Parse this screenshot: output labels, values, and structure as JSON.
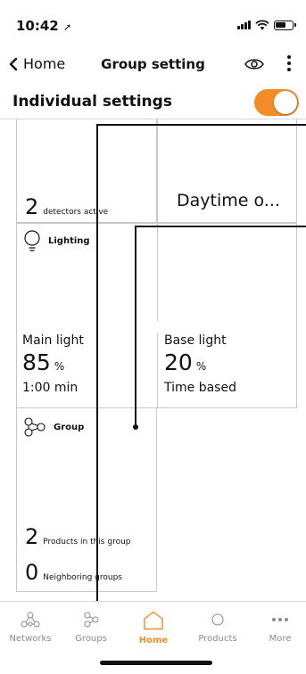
{
  "status_bar": {
    "time": "10:42"
  },
  "nav": {
    "back_label": "Home",
    "title": "Group setting"
  },
  "section": {
    "title": "Individual settings",
    "toggle_on": true,
    "accent": "#f28c28"
  },
  "tiles": {
    "detectors": {
      "value": "2",
      "label": "detectors active"
    },
    "daytime": {
      "value": "Daytime o..."
    },
    "lighting": {
      "title": "Lighting",
      "main": {
        "name": "Main light",
        "value": "85",
        "unit": "%",
        "extra": "1:00 min"
      },
      "base": {
        "name": "Base light",
        "value": "20",
        "unit": "%",
        "extra": "Time based"
      }
    },
    "group": {
      "title": "Group",
      "products_value": "2",
      "products_label": "Products in this group",
      "neighbors_value": "0",
      "neighbors_label": "Neighboring groups"
    }
  },
  "tabbar": {
    "items": [
      {
        "label": "Networks",
        "icon": "networks-icon"
      },
      {
        "label": "Groups",
        "icon": "groups-icon"
      },
      {
        "label": "Home",
        "icon": "home-icon",
        "active": true
      },
      {
        "label": "Products",
        "icon": "products-icon"
      },
      {
        "label": "More",
        "icon": "more-icon"
      }
    ]
  }
}
